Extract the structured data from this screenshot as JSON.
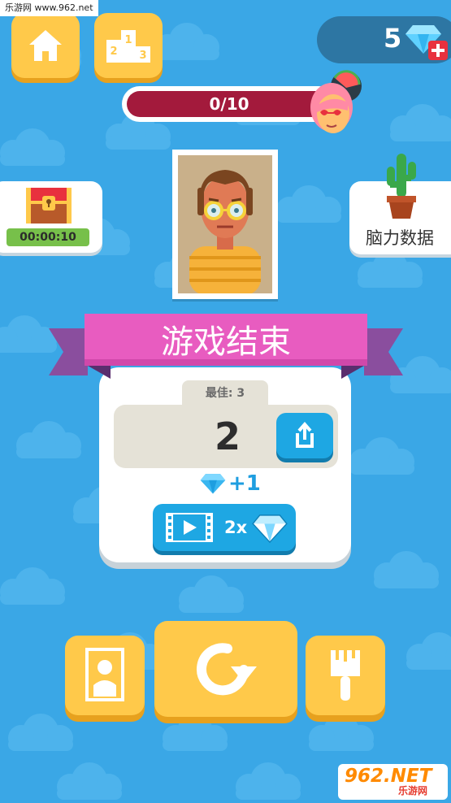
{
  "watermark": {
    "top_text": "乐游网 www.962.net",
    "logo_main": "962.NET",
    "logo_sub": "乐游网"
  },
  "top_bar": {
    "home_icon": "home-icon",
    "leaderboard_icon": "podium-icon",
    "podium_numbers": [
      "2",
      "1",
      "3"
    ],
    "gem_count": "5",
    "gem_icon": "diamond-icon",
    "add_icon": "plus-icon"
  },
  "progress": {
    "label": "0/10",
    "fraction": 0.0,
    "avatar_icon": "character-avatar-icon"
  },
  "chest": {
    "icon": "treasure-chest-icon",
    "timer": "00:00:10",
    "timer_fill": 1.0
  },
  "brain_stats": {
    "icon": "cactus-icon",
    "label": "脑力数据"
  },
  "portrait": {
    "icon": "man-portrait-icon"
  },
  "result": {
    "title": "游戏结束",
    "best_label": "最佳: 3",
    "score": "2",
    "share_icon": "share-icon",
    "reward_text": "+1",
    "video_icon": "film-play-icon",
    "video_multiplier": "2x"
  },
  "bottom_actions": {
    "gallery_icon": "portrait-gallery-icon",
    "replay_icon": "replay-icon",
    "paint_icon": "paint-brush-icon"
  },
  "colors": {
    "background": "#3aa7e6",
    "button_yellow": "#ffc94a",
    "ribbon_pink": "#e85cc0",
    "progress_track": "#a31a3c",
    "accent_blue": "#1ea7e3",
    "timer_green": "#77c04a"
  }
}
